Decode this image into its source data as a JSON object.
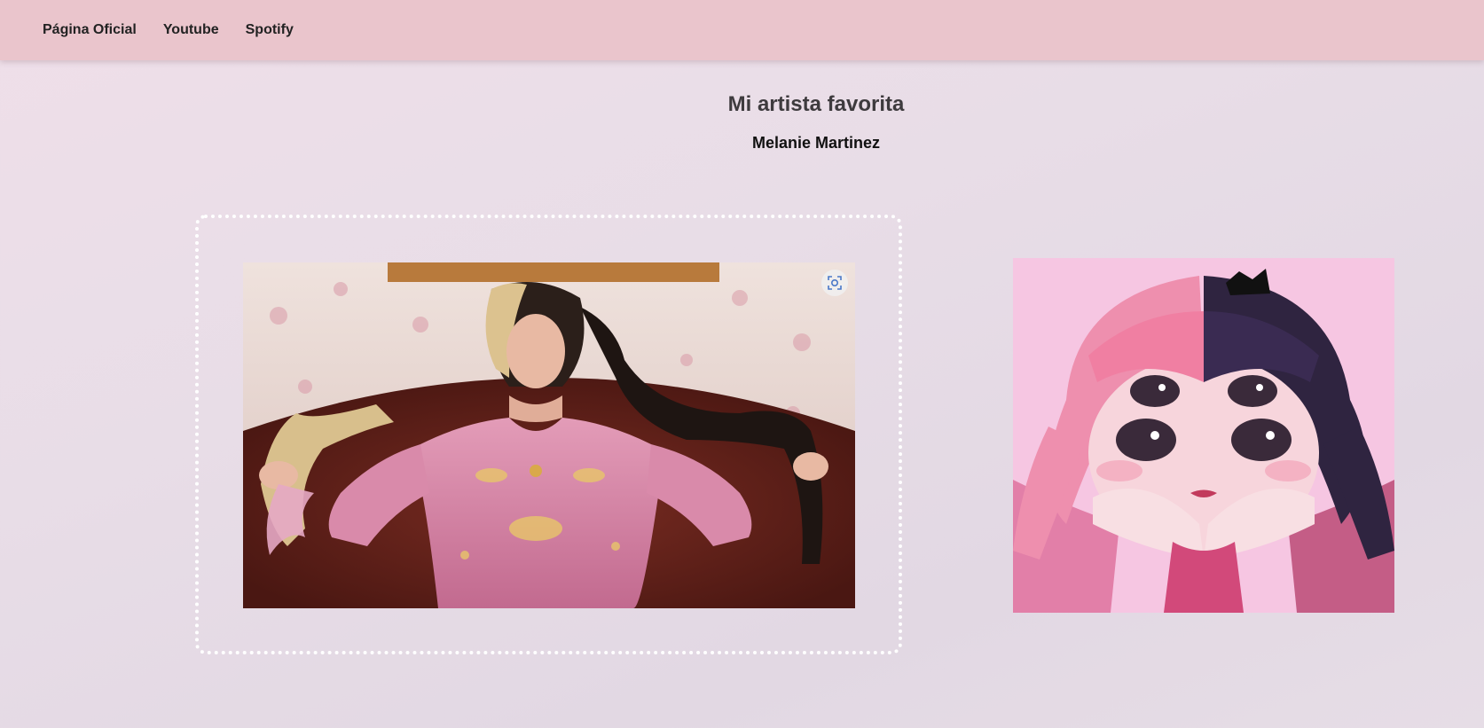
{
  "nav": {
    "links": [
      "Página Oficial",
      "Youtube",
      "Spotify"
    ]
  },
  "heading": {
    "title": "Mi artista favorita",
    "subtitle": "Melanie Martinez"
  },
  "images": {
    "photo_icon": "visual-search-icon",
    "colors": {
      "navbar": "#eac5cc",
      "frame_border": "#ffffff",
      "art_background": "#f6c6e2"
    }
  }
}
